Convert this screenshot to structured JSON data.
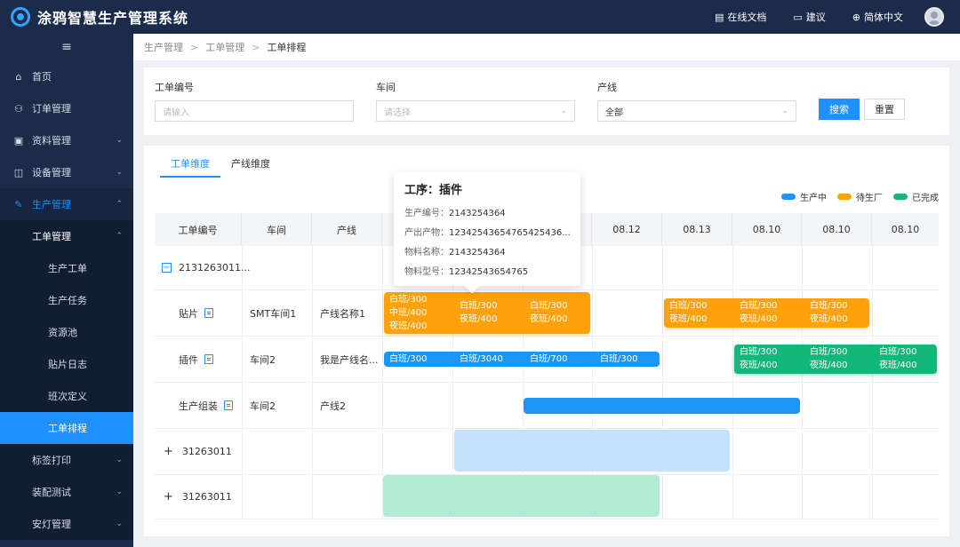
{
  "app": {
    "title": "涂鸦智慧生产管理系统"
  },
  "top_actions": [
    {
      "label": "在线文档",
      "icon": "document-icon"
    },
    {
      "label": "建议",
      "icon": "chat-icon"
    },
    {
      "label": "简体中文",
      "icon": "globe-icon"
    }
  ],
  "sidebar": {
    "items": [
      {
        "label": "首页",
        "icon": "home-icon"
      },
      {
        "label": "订单管理",
        "icon": "org-icon"
      },
      {
        "label": "资料管理",
        "icon": "file-icon"
      },
      {
        "label": "设备管理",
        "icon": "device-icon"
      },
      {
        "label": "生产管理",
        "icon": "wrench-icon"
      }
    ],
    "sub_group": "工单管理",
    "sub_items": [
      "生产工单",
      "生产任务",
      "资源池",
      "贴片日志",
      "班次定义",
      "工单排程"
    ],
    "after_items": [
      "标签打印",
      "装配测试",
      "安灯管理"
    ]
  },
  "breadcrumb": [
    "生产管理",
    "工单管理",
    "工单排程"
  ],
  "filters": {
    "order_no": {
      "label": "工单编号",
      "placeholder": "请输入"
    },
    "workshop": {
      "label": "车间",
      "placeholder": "请选择"
    },
    "line": {
      "label": "产线",
      "value": "全部"
    },
    "search_label": "搜索",
    "reset_label": "重置"
  },
  "tabs": [
    "工单维度",
    "产线维度"
  ],
  "legend": [
    {
      "label": "生产中",
      "color": "#1b95f6"
    },
    {
      "label": "待生厂",
      "color": "#ffa10a"
    },
    {
      "label": "已完成",
      "color": "#13b77a"
    }
  ],
  "table": {
    "headers": [
      "工单编号",
      "车间",
      "产线"
    ],
    "dates": [
      "08.12",
      "08.13",
      "08.10",
      "08.10",
      "08.10"
    ],
    "rows": [
      {
        "order": "2131263011...",
        "workshop": "",
        "line": ""
      },
      {
        "order": "贴片",
        "workshop": "SMT车间1",
        "line": "产线名称1"
      },
      {
        "order": "插件",
        "workshop": "车间2",
        "line": "我是产线名..."
      },
      {
        "order": "生产组装",
        "workshop": "车间2",
        "line": "产线2"
      },
      {
        "order": "31263011",
        "workshop": "",
        "line": ""
      },
      {
        "order": "31263011",
        "workshop": "",
        "line": ""
      }
    ]
  },
  "bars": {
    "smt_a": [
      "白班/300",
      "中班/400",
      "夜班/400",
      "白班/300",
      "夜班/400",
      "白班/300",
      "夜班/400"
    ],
    "smt_b": [
      "白班/300",
      "夜班/400",
      "白班/300",
      "夜班/400",
      "白班/300",
      "夜班/400"
    ],
    "plugin_a": [
      "白班/300",
      "白班/3040",
      "白班/700",
      "白班/300"
    ],
    "plugin_b": [
      "白班/300",
      "夜班/400",
      "白班/300",
      "夜班/400",
      "白班/300",
      "夜班/400"
    ]
  },
  "tooltip": {
    "title": "工序：插件",
    "rows": [
      {
        "k": "生产编号：",
        "v": "2143254364"
      },
      {
        "k": "产出产物：",
        "v": "12342543654765425436..."
      },
      {
        "k": "物料名称：",
        "v": "2143254364"
      },
      {
        "k": "物料型号：",
        "v": "12342543654765"
      }
    ]
  }
}
